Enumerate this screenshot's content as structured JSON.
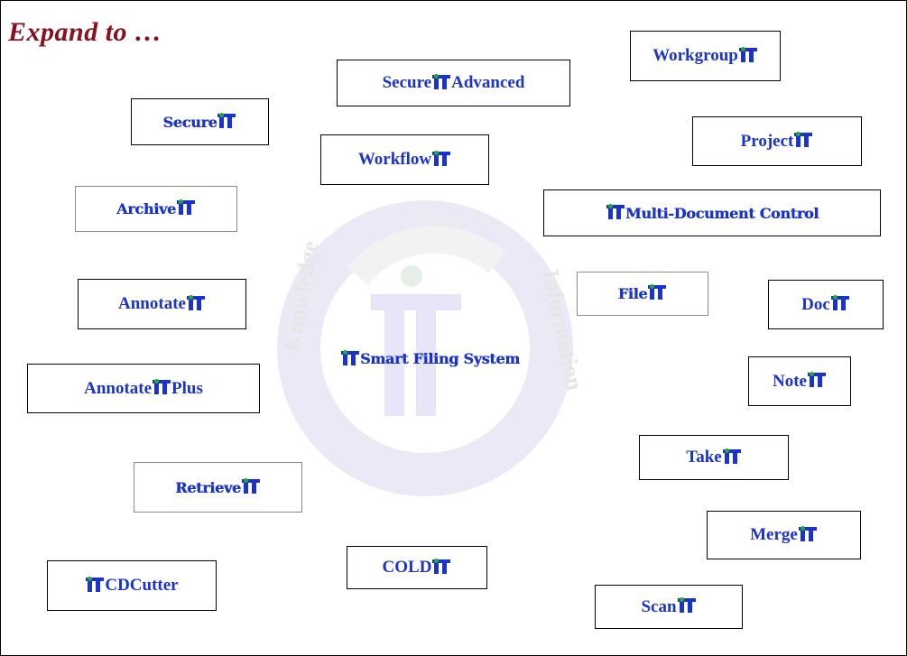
{
  "title": "Expand to …",
  "center": "Smart Filing System",
  "watermark": {
    "top": "Data",
    "right": "Information",
    "left": "Knowledge"
  },
  "modules": {
    "secure_advanced": {
      "pre": "Secure ",
      "post": "Advanced"
    },
    "workgroup": {
      "pre": "Workgroup",
      "post": ""
    },
    "secure": {
      "pre": "Secure",
      "post": ""
    },
    "workflow": {
      "pre": "Workflow",
      "post": ""
    },
    "project": {
      "pre": "Project ",
      "post": ""
    },
    "archive": {
      "pre": "Archive",
      "post": ""
    },
    "multi_doc": {
      "pre": "",
      "post": "Multi-Document Control"
    },
    "annotate": {
      "pre": "Annotate",
      "post": ""
    },
    "file": {
      "pre": "File",
      "post": ""
    },
    "doc": {
      "pre": "Doc ",
      "post": ""
    },
    "annotate_plus": {
      "pre": "Annotate",
      "post": " Plus"
    },
    "note": {
      "pre": "Note ",
      "post": ""
    },
    "retrieve": {
      "pre": "Retrieve",
      "post": ""
    },
    "take": {
      "pre": "Take ",
      "post": ""
    },
    "merge": {
      "pre": "Merge",
      "post": ""
    },
    "cdcutter": {
      "pre": "",
      "post": "CDCutter"
    },
    "cold": {
      "pre": "COLD ",
      "post": ""
    },
    "scan": {
      "pre": "Scan",
      "post": ""
    }
  },
  "colors": {
    "label": "#1a33cc",
    "title": "#8a1020",
    "watermark": "#e3e3f6"
  }
}
